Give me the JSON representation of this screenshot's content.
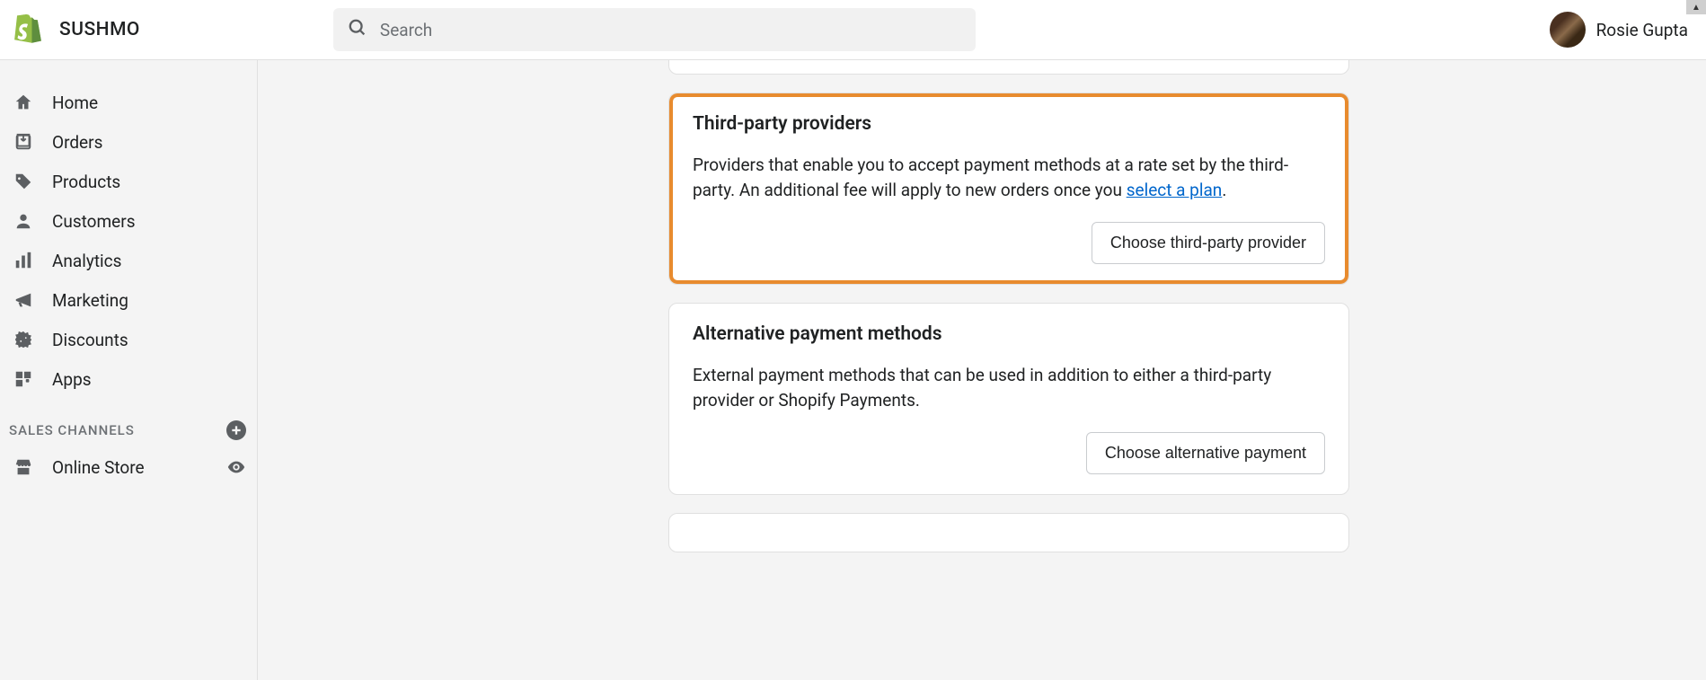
{
  "header": {
    "store_name": "SUSHMO",
    "search_placeholder": "Search",
    "user_name": "Rosie Gupta"
  },
  "sidebar": {
    "items": [
      {
        "icon": "home",
        "label": "Home"
      },
      {
        "icon": "orders",
        "label": "Orders"
      },
      {
        "icon": "products",
        "label": "Products"
      },
      {
        "icon": "customers",
        "label": "Customers"
      },
      {
        "icon": "analytics",
        "label": "Analytics"
      },
      {
        "icon": "marketing",
        "label": "Marketing"
      },
      {
        "icon": "discounts",
        "label": "Discounts"
      },
      {
        "icon": "apps",
        "label": "Apps"
      }
    ],
    "section_label": "SALES CHANNELS",
    "channels": [
      {
        "icon": "store",
        "label": "Online Store"
      }
    ]
  },
  "main": {
    "cards": [
      {
        "id": "third_party",
        "title": "Third-party providers",
        "body_prefix": "Providers that enable you to accept payment methods at a rate set by the third-party. An additional fee will apply to new orders once you ",
        "body_link": "select a plan",
        "body_suffix": ".",
        "button": "Choose third-party provider",
        "highlighted": true
      },
      {
        "id": "alt_methods",
        "title": "Alternative payment methods",
        "body": "External payment methods that can be used in addition to either a third-party provider or Shopify Payments.",
        "button": "Choose alternative payment",
        "highlighted": false
      },
      {
        "id": "manual_cutoff",
        "title_partial": ""
      }
    ]
  }
}
